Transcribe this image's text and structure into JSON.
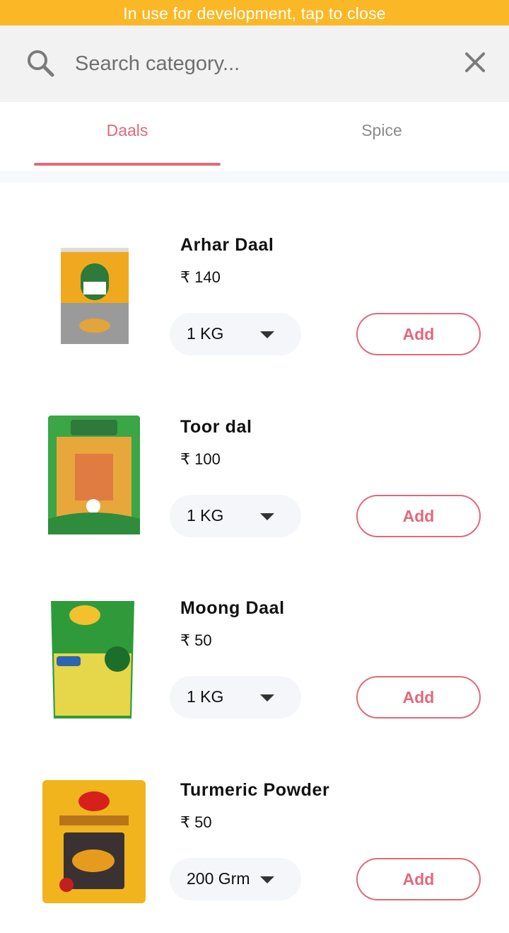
{
  "dev_banner": {
    "text": "In use for development, tap to close"
  },
  "search": {
    "placeholder": "Search category...",
    "value": ""
  },
  "tabs": [
    {
      "label": "Daals",
      "active": true
    },
    {
      "label": "Spice",
      "active": false
    }
  ],
  "colors": {
    "accent": "#e0697c",
    "banner": "#fbb826",
    "search_bg": "#f2f2f2",
    "pill_bg": "#f4f6fa"
  },
  "currency_symbol": "₹",
  "products": [
    {
      "name": "Arhar Daal",
      "price": "₹ 140",
      "quantity": "1 KG",
      "add_label": "Add",
      "image_icon": "arhar-daal-pack-image"
    },
    {
      "name": "Toor dal",
      "price": "₹ 100",
      "quantity": "1 KG",
      "add_label": "Add",
      "image_icon": "toor-dal-pack-image"
    },
    {
      "name": "Moong Daal",
      "price": "₹ 50",
      "quantity": "1 KG",
      "add_label": "Add",
      "image_icon": "moong-dal-pack-image"
    },
    {
      "name": "Turmeric Powder",
      "price": "₹ 50",
      "quantity": "200 Grm",
      "add_label": "Add",
      "image_icon": "turmeric-powder-pack-image"
    }
  ]
}
